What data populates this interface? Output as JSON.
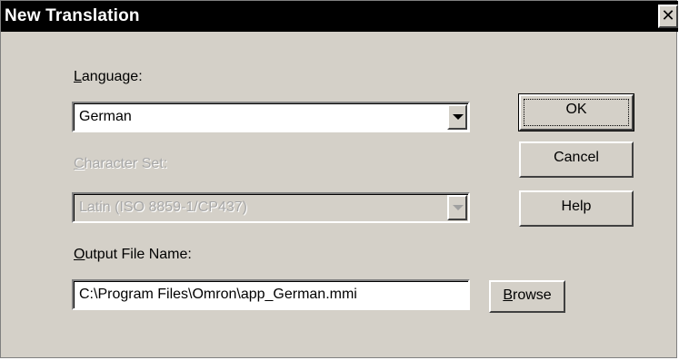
{
  "dialog": {
    "title": "New Translation",
    "close_glyph": "✕"
  },
  "language": {
    "label_accel": "L",
    "label_rest": "anguage:",
    "value": "German"
  },
  "character_set": {
    "label_accel": "C",
    "label_rest": "haracter Set:",
    "value": "Latin (ISO 8859-1/CP437)",
    "enabled": false
  },
  "output": {
    "label_accel": "O",
    "label_rest": "utput File Name:",
    "value": "C:\\Program Files\\Omron\\app_German.mmi"
  },
  "buttons": {
    "ok": "OK",
    "cancel": "Cancel",
    "help": "Help",
    "browse_accel": "B",
    "browse_rest": "rowse"
  },
  "icons": {
    "dropdown": "chevron-down-icon",
    "close": "close-icon"
  }
}
